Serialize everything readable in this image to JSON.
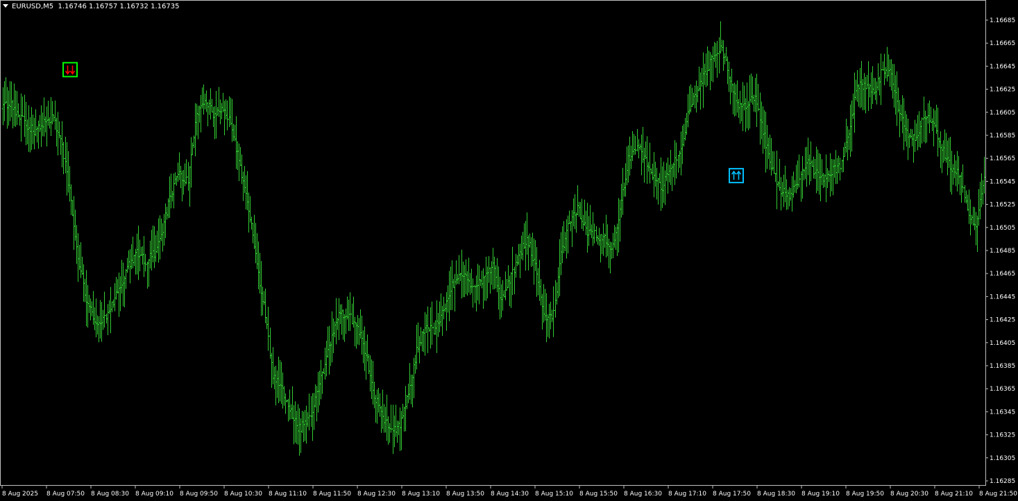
{
  "header": {
    "symbol": "EURUSD,M5",
    "ohlc": "1.16746 1.16757 1.16732 1.16735"
  },
  "colors": {
    "background": "#000000",
    "bars": "#32cd32",
    "grid_border": "#c0c0c0",
    "axis_text": "#ffffff",
    "sell_signal_box": "#00ff00",
    "sell_signal_arrow": "#ff0000",
    "buy_signal_box": "#00bfff",
    "buy_signal_arrow": "#00bfff"
  },
  "icons": {
    "sell_signal": "double-down-arrow-icon",
    "buy_signal": "double-up-arrow-icon",
    "header_menu": "triangle-down-icon"
  },
  "chart_data": {
    "type": "ohlc",
    "timeframe": "M5",
    "ylim": [
      1.16275,
      1.16695
    ],
    "y_ticks": [
      "1.16685",
      "1.16665",
      "1.16645",
      "1.16625",
      "1.16605",
      "1.16585",
      "1.16565",
      "1.16545",
      "1.16525",
      "1.16505",
      "1.16485",
      "1.16465",
      "1.16445",
      "1.16425",
      "1.16405",
      "1.16385",
      "1.16365",
      "1.16345",
      "1.16325",
      "1.16305",
      "1.16285"
    ],
    "x_ticks": [
      "8 Aug 2025",
      "8 Aug 07:50",
      "8 Aug 08:30",
      "8 Aug 09:10",
      "8 Aug 09:50",
      "8 Aug 10:30",
      "8 Aug 11:10",
      "8 Aug 11:50",
      "8 Aug 12:30",
      "8 Aug 13:10",
      "8 Aug 13:50",
      "8 Aug 14:30",
      "8 Aug 15:10",
      "8 Aug 15:50",
      "8 Aug 16:30",
      "8 Aug 17:10",
      "8 Aug 17:50",
      "8 Aug 18:30",
      "8 Aug 19:10",
      "8 Aug 19:50",
      "8 Aug 20:30",
      "8 Aug 21:10",
      "8 Aug 21:50"
    ],
    "close_path": [
      1.16608,
      1.16612,
      1.16604,
      1.16592,
      1.16588,
      1.16596,
      1.166,
      1.16584,
      1.16536,
      1.1648,
      1.16444,
      1.1642,
      1.16425,
      1.16437,
      1.16453,
      1.16472,
      1.16483,
      1.16475,
      1.16482,
      1.16503,
      1.16535,
      1.16551,
      1.16545,
      1.16604,
      1.16618,
      1.16602,
      1.16608,
      1.16598,
      1.16563,
      1.16531,
      1.16479,
      1.16437,
      1.16377,
      1.16366,
      1.16347,
      1.1633,
      1.16336,
      1.16354,
      1.16382,
      1.16412,
      1.16432,
      1.16428,
      1.16418,
      1.16395,
      1.16358,
      1.16342,
      1.16327,
      1.16335,
      1.16359,
      1.16397,
      1.16418,
      1.16416,
      1.1643,
      1.16452,
      1.16466,
      1.16459,
      1.16453,
      1.16461,
      1.16471,
      1.16442,
      1.16458,
      1.1648,
      1.16496,
      1.16472,
      1.16431,
      1.16424,
      1.16482,
      1.16511,
      1.16522,
      1.16503,
      1.16499,
      1.16496,
      1.16486,
      1.16519,
      1.16565,
      1.16576,
      1.16562,
      1.1655,
      1.1654,
      1.16557,
      1.1657,
      1.16602,
      1.16622,
      1.16638,
      1.16653,
      1.16661,
      1.16632,
      1.16608,
      1.16612,
      1.16618,
      1.16583,
      1.16554,
      1.16538,
      1.16533,
      1.16545,
      1.16563,
      1.16553,
      1.16547,
      1.16553,
      1.1656,
      1.16584,
      1.16629,
      1.16628,
      1.16622,
      1.16642,
      1.16639,
      1.16605,
      1.16586,
      1.16583,
      1.16602,
      1.16594,
      1.16573,
      1.16558,
      1.1655,
      1.16522,
      1.16503,
      1.16548
    ],
    "signals": [
      {
        "type": "sell",
        "time": "8 Aug 07:50",
        "price": 1.16642
      },
      {
        "type": "buy",
        "time": "8 Aug 17:50",
        "price": 1.1655
      }
    ]
  }
}
